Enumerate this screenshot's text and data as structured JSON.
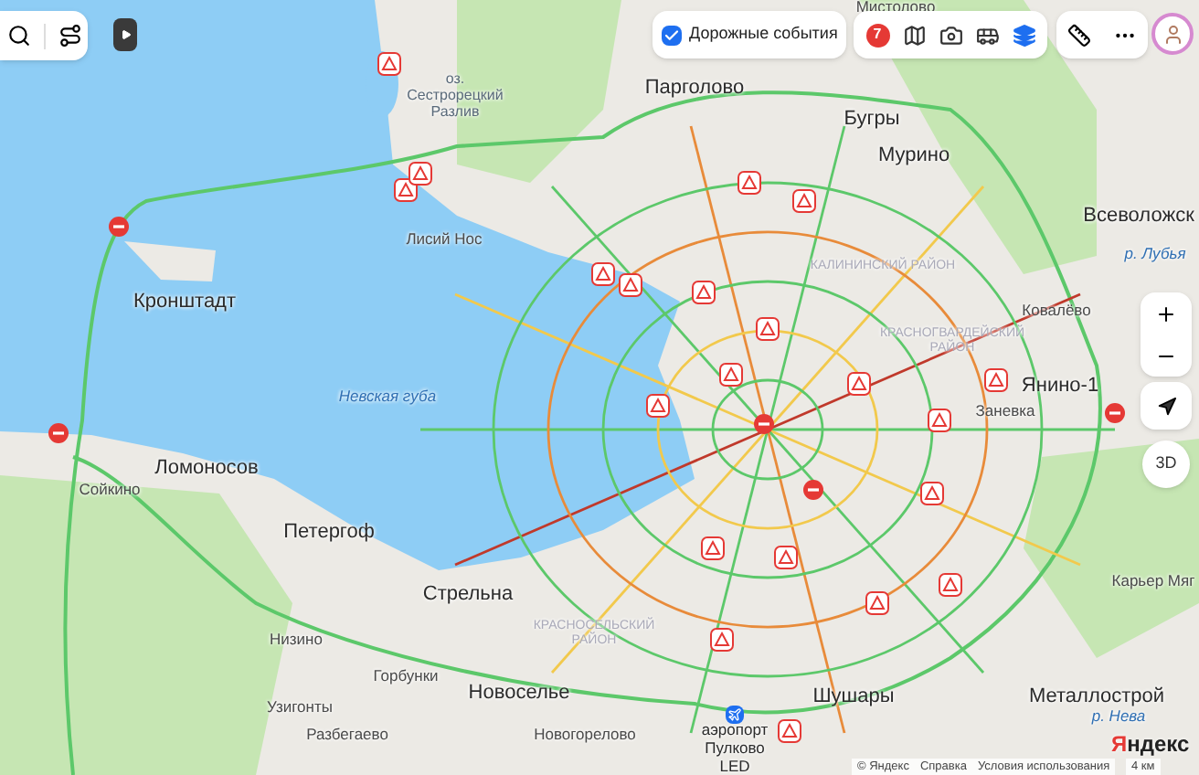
{
  "toolbar": {
    "traffic": {
      "label": "Дорожные события",
      "checked": true
    },
    "layers": [
      {
        "kind": "badge",
        "badge": "7"
      },
      {
        "kind": "panorama",
        "selected": false
      },
      {
        "kind": "camera",
        "selected": false
      },
      {
        "kind": "transport",
        "selected": false
      },
      {
        "kind": "layers",
        "selected": true
      }
    ]
  },
  "map": {
    "labels": [
      {
        "text": "Мистолово",
        "kind": "village"
      },
      {
        "text": "оз. Сестрорецкий Разлив",
        "kind": "lake"
      },
      {
        "text": "Парголово",
        "kind": "city"
      },
      {
        "text": "Бугры",
        "kind": "city"
      },
      {
        "text": "Мурино",
        "kind": "city"
      },
      {
        "text": "Всеволожск",
        "kind": "city"
      },
      {
        "text": "р. Лубья",
        "kind": "water"
      },
      {
        "text": "Лисий Нос",
        "kind": "village"
      },
      {
        "text": "Кронштадт",
        "kind": "city"
      },
      {
        "text": "КАЛИНИНСКИЙ РАЙОН",
        "kind": "district"
      },
      {
        "text": "Ковалёво",
        "kind": "village"
      },
      {
        "text": "КРАСНОГВАРДЕЙСКИЙ РАЙОН",
        "kind": "district"
      },
      {
        "text": "Невская губа",
        "kind": "water"
      },
      {
        "text": "Янино-1",
        "kind": "city"
      },
      {
        "text": "Заневка",
        "kind": "village"
      },
      {
        "text": "Ломоносов",
        "kind": "city"
      },
      {
        "text": "Сойкино",
        "kind": "village"
      },
      {
        "text": "Петергоф",
        "kind": "city"
      },
      {
        "text": "Карьер Мяг",
        "kind": "village"
      },
      {
        "text": "Стрельна",
        "kind": "city"
      },
      {
        "text": "Низино",
        "kind": "village"
      },
      {
        "text": "КРАСНОСЕЛЬСКИЙ РАЙОН",
        "kind": "district"
      },
      {
        "text": "Горбунки",
        "kind": "village"
      },
      {
        "text": "Новоселье",
        "kind": "city"
      },
      {
        "text": "Шушары",
        "kind": "city"
      },
      {
        "text": "Металлострой",
        "kind": "city"
      },
      {
        "text": "Узигонты",
        "kind": "village"
      },
      {
        "text": "р. Нева",
        "kind": "water"
      },
      {
        "text": "Разбегаево",
        "kind": "village"
      },
      {
        "text": "Новогорелово",
        "kind": "village"
      },
      {
        "text": "аэропорт Пулково LED",
        "kind": "airport"
      }
    ]
  },
  "controls": {
    "three_d": "3D"
  },
  "logo": {
    "mark": "Я",
    "rest": "ндекс"
  },
  "attribution": [
    "© Яндекс",
    "Справка",
    "Условия использования"
  ],
  "scale": "4 км"
}
